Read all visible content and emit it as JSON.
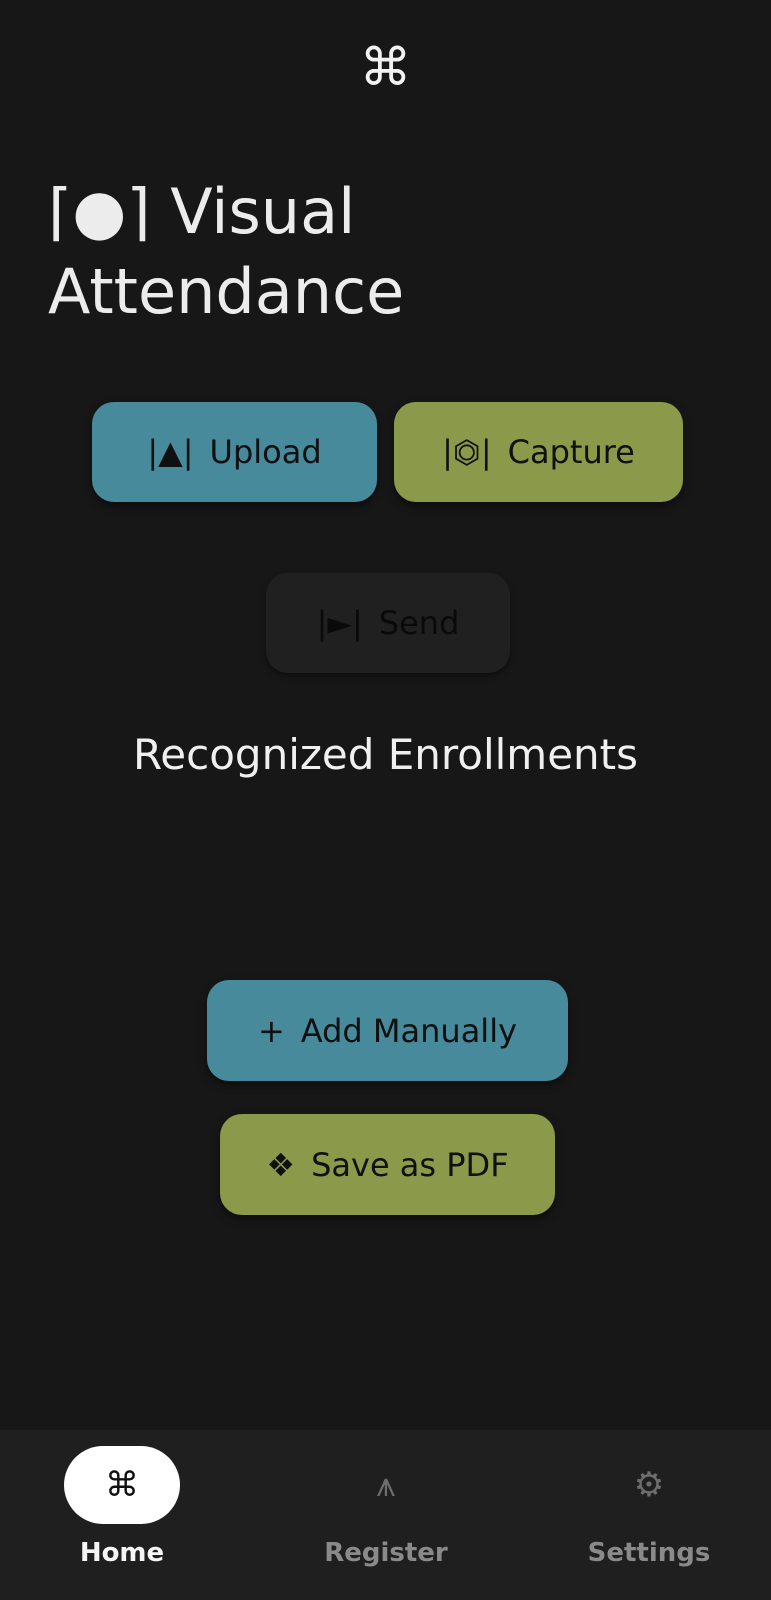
{
  "header": {
    "app_icon": "⌘"
  },
  "title": {
    "icon": "⌈●⌉",
    "line1": "Visual",
    "line2": "Attendance"
  },
  "actions": {
    "upload": {
      "glyph": "|▲|",
      "label": "Upload",
      "color": "#468a9b"
    },
    "capture": {
      "glyph": "|⏣|",
      "label": "Capture",
      "color": "#8b9a4a"
    },
    "send": {
      "glyph": "|►|",
      "label": "Send",
      "color": "#202020"
    }
  },
  "section": {
    "heading": "Recognized Enrollments"
  },
  "secondary_actions": {
    "add_manually": {
      "glyph": "+",
      "label": "Add Manually",
      "color": "#468a9b"
    },
    "save_pdf": {
      "glyph": "❖",
      "label": "Save as PDF",
      "color": "#8b9a4a"
    }
  },
  "bottom_nav": {
    "items": [
      {
        "icon": "⌘",
        "label": "Home",
        "active": true
      },
      {
        "icon": "⩚",
        "label": "Register",
        "active": false
      },
      {
        "icon": "⚙",
        "label": "Settings",
        "active": false
      }
    ]
  }
}
